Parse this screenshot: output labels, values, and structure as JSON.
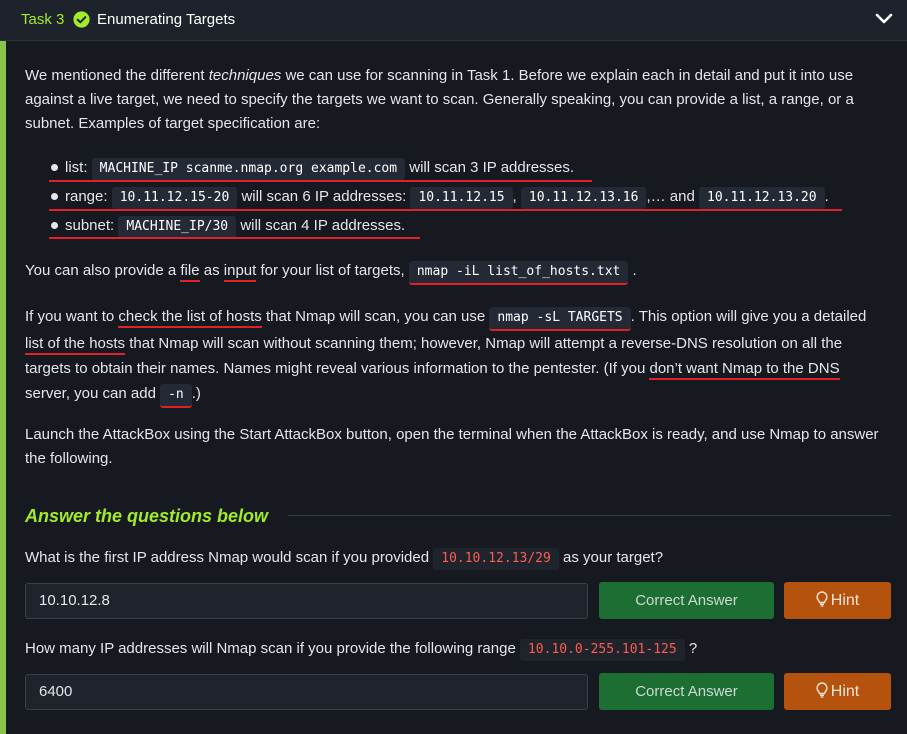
{
  "header": {
    "task_number": "Task 3",
    "title": "Enumerating Targets"
  },
  "intro": {
    "a": "We mentioned the different ",
    "em": "techniques",
    "b": " we can use for scanning in Task 1. Before we explain each in detail and put it into use against a live target, we need to specify the targets we want to scan. Generally speaking, you can provide a list, a range, or a subnet. Examples of target specification are:"
  },
  "bullets": {
    "list": {
      "label": "list:",
      "code": "MACHINE_IP scanme.nmap.org example.com",
      "text": "will scan 3 IP addresses."
    },
    "range": {
      "label": "range:",
      "code1": "10.11.12.15-20",
      "text1": "will scan 6 IP addresses:",
      "code2": "10.11.12.15",
      "comma": ",",
      "code3": "10.11.12.13.16",
      "text2": ",… and",
      "code4": "10.11.12.13.20",
      "period": "."
    },
    "subnet": {
      "label": "subnet:",
      "code": "MACHINE_IP/30",
      "text": "will scan 4 IP addresses."
    }
  },
  "file_para": {
    "a": "You can also provide a ",
    "b": "file",
    "c": " as ",
    "d": "input",
    "e": " for your list of targets,",
    "code": "nmap -iL list_of_hosts.txt",
    "end": "."
  },
  "check_para": {
    "a": "If you want to ",
    "b": "check the list of hosts",
    "c": " that Nmap will scan, you can use ",
    "code": "nmap -sL TARGETS",
    "d": ". This option will give you a detailed ",
    "e": "list of the hosts",
    "f": " that Nmap will scan without scanning them; however, Nmap will attempt a reverse-DNS resolution on all the targets to obtain their names. Names might reveal various information to the pentester. (If you ",
    "g": "don’t want Nmap to the DNS",
    "h": " server, you can add ",
    "code2": "-n",
    "i": ".)"
  },
  "launch_para": "Launch the AttackBox using the Start AttackBox button, open the terminal when the AttackBox is ready, and use Nmap to answer the following.",
  "answers": {
    "title": "Answer the questions below",
    "q1": {
      "text": "What is the first IP address Nmap would scan if you provided",
      "code": "10.10.12.13/29",
      "tail": "as your target?",
      "answer": "10.10.12.8",
      "correct": "Correct Answer",
      "hint": "Hint"
    },
    "q2": {
      "text": "How many IP addresses will Nmap scan if you provide the following range",
      "code": "10.10.0-255.101-125",
      "tail": "?",
      "answer": "6400",
      "correct": "Correct Answer",
      "hint": "Hint"
    }
  },
  "colors": {
    "accent": "#a3ea2a",
    "underline": "#e0202a",
    "correct_btn": "#1c6e33",
    "hint_btn": "#b5520e"
  },
  "icons": {
    "check": "check-circle-icon",
    "chevron": "chevron-down-icon",
    "hint": "lightbulb-icon"
  }
}
